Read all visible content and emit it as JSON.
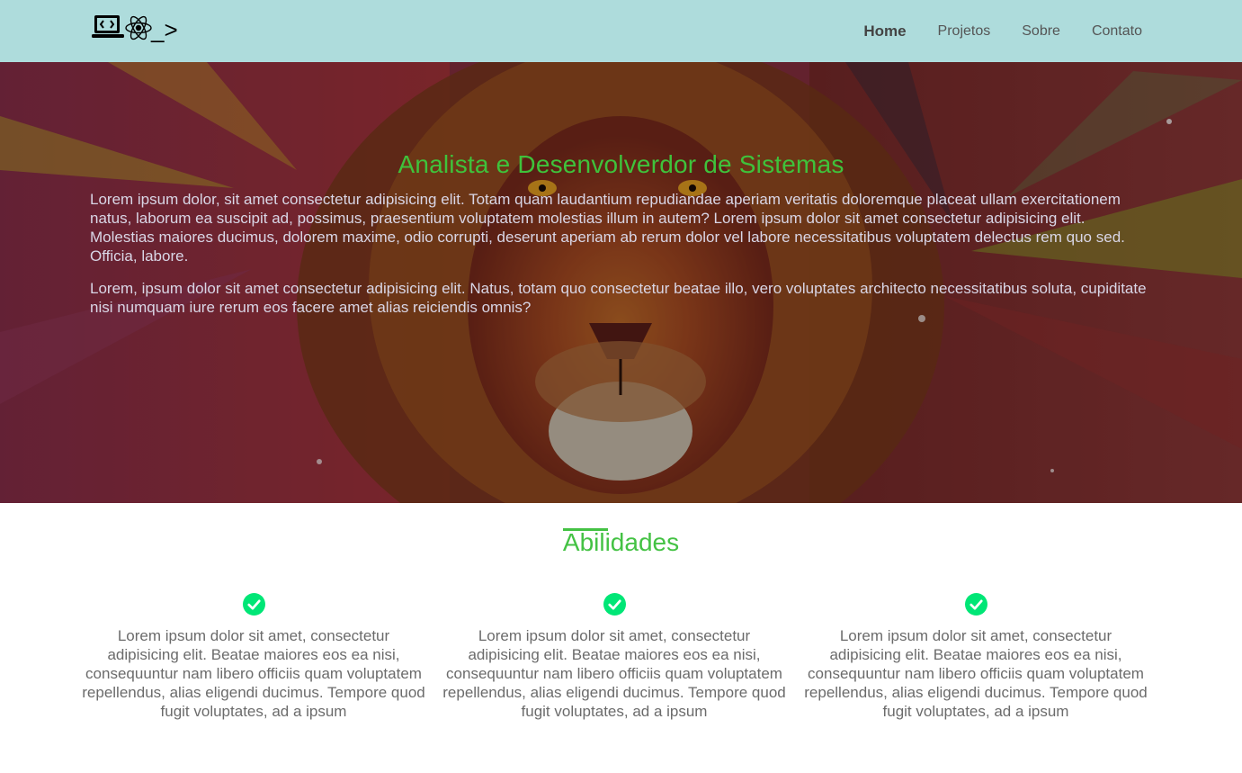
{
  "header": {
    "logo_icons": [
      "laptop-code-icon",
      "react-atom-icon"
    ],
    "logo_text": "_>",
    "nav": [
      {
        "label": "Home",
        "active": true
      },
      {
        "label": "Projetos",
        "active": false
      },
      {
        "label": "Sobre",
        "active": false
      },
      {
        "label": "Contato",
        "active": false
      }
    ],
    "bg_color": "#aedcdc"
  },
  "hero": {
    "title": "Analista e Desenvolverdor de Sistemas",
    "paragraphs": [
      "Lorem ipsum dolor, sit amet consectetur adipisicing elit. Totam quam laudantium repudiandae aperiam veritatis doloremque placeat ullam exercitationem natus, laborum ea suscipit ad, possimus, praesentium voluptatem molestias illum in autem? Lorem ipsum dolor sit amet consectetur adipisicing elit. Molestias maiores ducimus, dolorem maxime, odio corrupti, deserunt aperiam ab rerum dolor vel labore necessitatibus voluptatem delectus rem quo sed. Officia, labore.",
      "Lorem, ipsum dolor sit amet consectetur adipisicing elit. Natus, totam quo consectetur beatae illo, vero voluptates architecto necessitatibus soluta, cupiditate nisi numquam iure rerum eos facere amet alias reiciendis omnis?"
    ],
    "background_image": "lion-artwork",
    "title_color": "#3fc23b"
  },
  "skills": {
    "title": "Abilidades",
    "accent_color": "#44c244",
    "items": [
      {
        "icon": "check-circle-icon",
        "text": "Lorem ipsum dolor sit amet, consectetur adipisicing elit. Beatae maiores eos ea nisi, consequuntur nam libero officiis quam voluptatem repellendus, alias eligendi ducimus. Tempore quod fugit voluptates, ad a ipsum"
      },
      {
        "icon": "check-circle-icon",
        "text": "Lorem ipsum dolor sit amet, consectetur adipisicing elit. Beatae maiores eos ea nisi, consequuntur nam libero officiis quam voluptatem repellendus, alias eligendi ducimus. Tempore quod fugit voluptates, ad a ipsum"
      },
      {
        "icon": "check-circle-icon",
        "text": "Lorem ipsum dolor sit amet, consectetur adipisicing elit. Beatae maiores eos ea nisi, consequuntur nam libero officiis quam voluptatem repellendus, alias eligendi ducimus. Tempore quod fugit voluptates, ad a ipsum"
      }
    ],
    "icon_color": "#00e676"
  }
}
